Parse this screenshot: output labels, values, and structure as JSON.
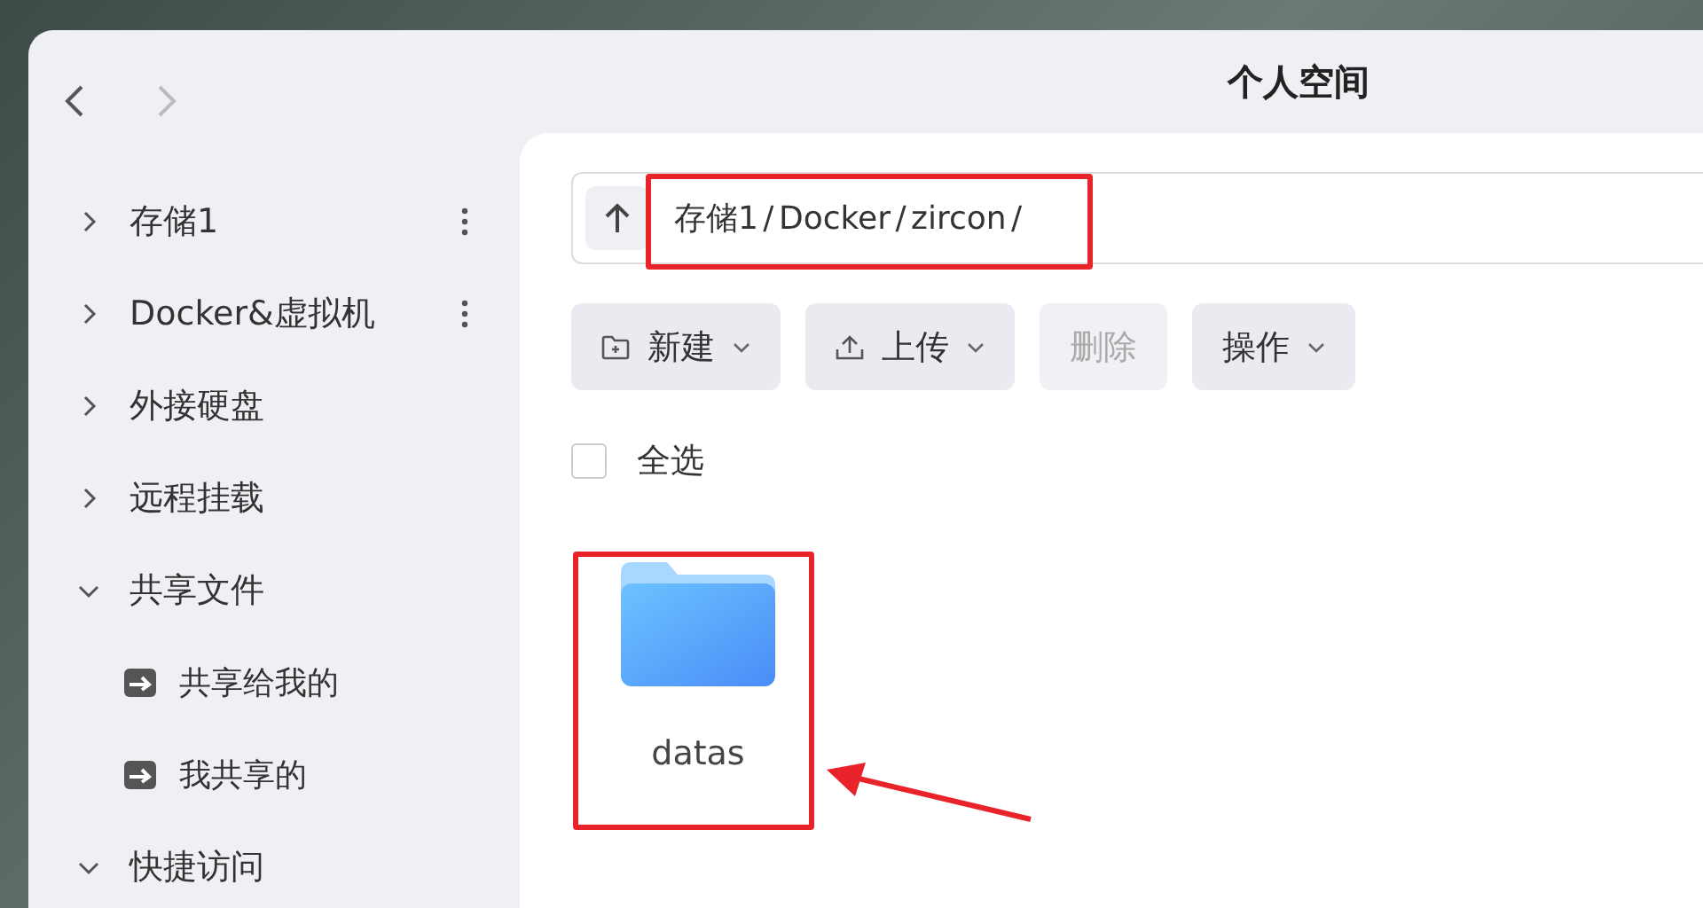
{
  "window": {
    "title": "个人空间"
  },
  "sidebar": {
    "items": [
      {
        "label": "存储1",
        "expanded": false,
        "has_menu": true
      },
      {
        "label": "Docker&虚拟机",
        "expanded": false,
        "has_menu": true
      },
      {
        "label": "外接硬盘",
        "expanded": false,
        "has_menu": false
      },
      {
        "label": "远程挂载",
        "expanded": false,
        "has_menu": false
      },
      {
        "label": "共享文件",
        "expanded": true,
        "has_menu": false,
        "children": [
          {
            "label": "共享给我的"
          },
          {
            "label": "我共享的"
          }
        ]
      },
      {
        "label": "快捷访问",
        "expanded": true,
        "has_menu": false
      }
    ]
  },
  "path_bar": {
    "path": "存储1 / Docker / zircon /"
  },
  "toolbar": [
    {
      "label": "新建",
      "kind": "new",
      "disabled": false,
      "dropdown": true
    },
    {
      "label": "上传",
      "kind": "upload",
      "disabled": false,
      "dropdown": true
    },
    {
      "label": "删除",
      "kind": "plain",
      "disabled": true,
      "dropdown": false
    },
    {
      "label": "操作",
      "kind": "plain",
      "disabled": false,
      "dropdown": true
    }
  ],
  "select_all": {
    "label": "全选",
    "checked": false
  },
  "files": [
    {
      "name": "datas"
    }
  ]
}
